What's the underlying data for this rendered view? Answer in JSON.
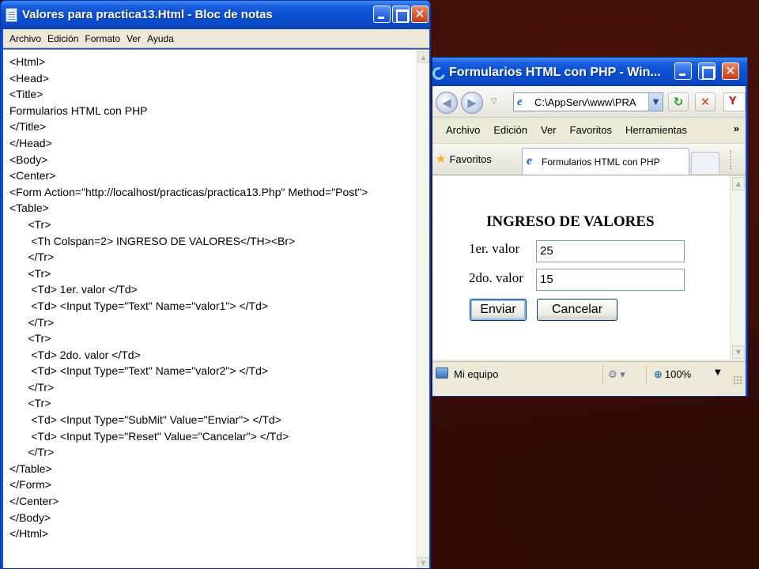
{
  "notepad": {
    "title": "Valores para practica13.Html - Bloc de notas",
    "menu": [
      "Archivo",
      "Edición",
      "Formato",
      "Ver",
      "Ayuda"
    ],
    "content": "<Html>\n<Head>\n<Title>\nFormularios HTML con PHP\n</Title>\n</Head>\n<Body>\n<Center>\n<Form Action=\"http://localhost/practicas/practica13.Php\" Method=\"Post\">\n<Table>\n      <Tr>\n       <Th Colspan=2> INGRESO DE VALORES</TH><Br>\n      </Tr>\n      <Tr>\n       <Td> 1er. valor </Td>\n       <Td> <Input Type=\"Text\" Name=\"valor1\"> </Td>\n      </Tr>\n      <Tr>\n       <Td> 2do. valor </Td>\n       <Td> <Input Type=\"Text\" Name=\"valor2\"> </Td>\n      </Tr>\n      <Tr>\n       <Td> <Input Type=\"SubMit\" Value=\"Enviar\"> </Td>\n       <Td> <Input Type=\"Reset\" Value=\"Cancelar\"> </Td>\n      </Tr>\n</Table>\n</Form>\n</Center>\n</Body>\n</Html>"
  },
  "browser": {
    "title": "Formularios HTML con PHP - Win...",
    "address": "C:\\AppServ\\www\\PRA",
    "menu": [
      "Archivo",
      "Edición",
      "Ver",
      "Favoritos",
      "Herramientas"
    ],
    "more_menu": "»",
    "favorites_label": "Favoritos",
    "tab_title": "Formularios HTML con PHP",
    "form": {
      "heading": "INGRESO DE VALORES",
      "label1": "1er. valor",
      "value1": "25",
      "label2": "2do. valor",
      "value2": "15",
      "submit": "Enviar",
      "reset": "Cancelar"
    },
    "status": {
      "text": "Mi equipo",
      "zoom": "100%"
    }
  },
  "icons": {
    "notepad_icon": "notepad-icon",
    "ie_icon": "ie-icon",
    "back": "back-arrow-icon",
    "forward": "forward-arrow-icon",
    "refresh": "refresh-icon",
    "stop": "stop-icon",
    "star": "favorites-star-icon",
    "computer": "computer-icon",
    "zoom": "magnifier-icon"
  }
}
